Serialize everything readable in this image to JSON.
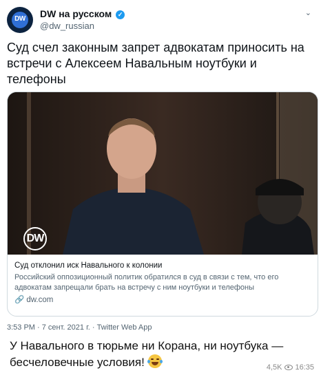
{
  "account": {
    "name": "DW на русском",
    "handle": "@dw_russian",
    "avatar_label": "DW",
    "verified": true
  },
  "tweet": {
    "text": "Суд счел законным запрет адвокатам приносить на встречи с Алексеем Навальным ноутбуки и телефоны"
  },
  "card": {
    "logo_label": "DW",
    "title": "Суд отклонил иск Навального к колонии",
    "description": "Российский оппозиционный политик обратился в суд в связи с тем, что его адвокатам запрещали брать на встречу с ним ноутбуки и телефоны",
    "domain": "dw.com"
  },
  "meta": {
    "time_line": "3:53 PM · 7 сент. 2021 г. · Twitter Web App"
  },
  "caption": {
    "text": "У Навального в тюрьме ни Корана, ни ноутбука — бесчеловечные условия!"
  },
  "stats": {
    "views": "4,5K",
    "time": "16:35"
  },
  "icons": {
    "link": "link-icon",
    "eye": "eye-icon",
    "emoji": "laughing-emoji-icon",
    "verified": "verified-badge-icon"
  },
  "colors": {
    "verified": "#1d9bf0",
    "secondary_text": "#536471",
    "dw_blue": "#2f6fd6"
  }
}
